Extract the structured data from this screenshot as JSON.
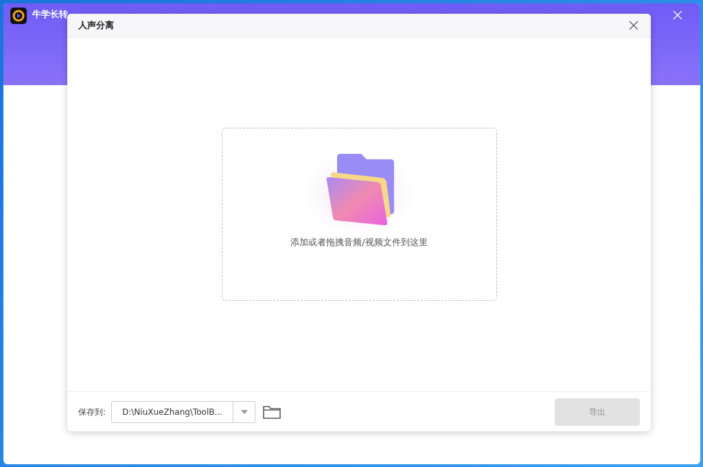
{
  "app": {
    "title": "牛学长转"
  },
  "dialog": {
    "title": "人声分离",
    "drop_zone": {
      "hint": "添加或者拖拽音频/视频文件到这里"
    },
    "footer": {
      "save_label": "保存到:",
      "save_path": "D:\\NiuXueZhang\\ToolB...",
      "export_button": {
        "label": "导出",
        "disabled": true
      }
    }
  }
}
